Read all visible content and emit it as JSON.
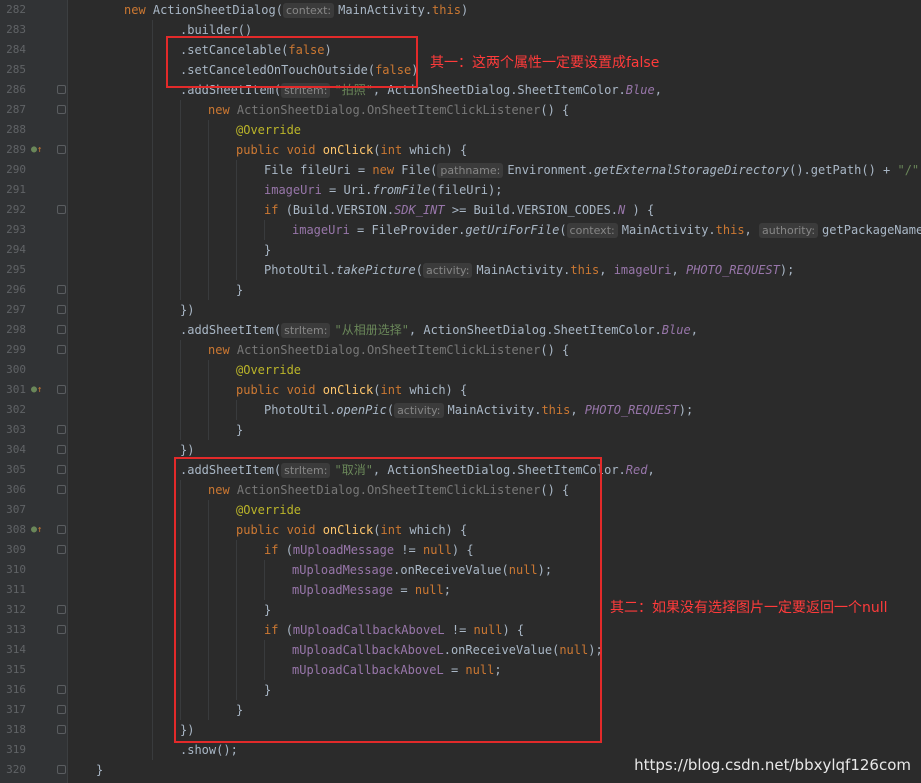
{
  "editor": {
    "lines": [
      {
        "n": "282",
        "indent": 0,
        "fold": false,
        "marker": false,
        "t": [
          [
            "kw",
            "new "
          ],
          [
            "",
            "ActionSheetDialog("
          ],
          [
            "hint",
            "context:"
          ],
          [
            "",
            "MainActivity."
          ],
          [
            "kw",
            "this"
          ],
          [
            "",
            ")"
          ]
        ]
      },
      {
        "n": "283",
        "indent": 1,
        "fold": false,
        "marker": false,
        "t": [
          [
            "",
            ".builder()"
          ]
        ]
      },
      {
        "n": "284",
        "indent": 1,
        "fold": false,
        "marker": false,
        "t": [
          [
            "",
            ".setCancelable("
          ],
          [
            "kw",
            "false"
          ],
          [
            "",
            ")"
          ]
        ]
      },
      {
        "n": "285",
        "indent": 1,
        "fold": false,
        "marker": false,
        "t": [
          [
            "",
            ".setCanceledOnTouchOutside("
          ],
          [
            "kw",
            "false"
          ],
          [
            "",
            ")"
          ]
        ]
      },
      {
        "n": "286",
        "indent": 1,
        "fold": true,
        "marker": false,
        "t": [
          [
            "",
            ".addSheetItem("
          ],
          [
            "hint",
            "strItem:"
          ],
          [
            "str",
            "\"拍照\""
          ],
          [
            "",
            ", ActionSheetDialog.SheetItemColor."
          ],
          [
            "fldi",
            "Blue"
          ],
          [
            "",
            ","
          ]
        ]
      },
      {
        "n": "287",
        "indent": 2,
        "fold": true,
        "marker": false,
        "t": [
          [
            "kw",
            "new "
          ],
          [
            "dim",
            "ActionSheetDialog.OnSheetItemClickListener"
          ],
          [
            "",
            "() {"
          ]
        ]
      },
      {
        "n": "288",
        "indent": 3,
        "fold": false,
        "marker": false,
        "t": [
          [
            "ann",
            "@Override"
          ]
        ]
      },
      {
        "n": "289",
        "indent": 3,
        "fold": true,
        "marker": true,
        "t": [
          [
            "kw",
            "public void "
          ],
          [
            "fn",
            "onClick"
          ],
          [
            "",
            "("
          ],
          [
            "kw",
            "int "
          ],
          [
            "",
            "which) {"
          ]
        ]
      },
      {
        "n": "290",
        "indent": 4,
        "fold": false,
        "marker": false,
        "t": [
          [
            "",
            "File fileUri = "
          ],
          [
            "kw",
            "new "
          ],
          [
            "",
            "File("
          ],
          [
            "hint",
            "pathname:"
          ],
          [
            "",
            "Environment."
          ],
          [
            "st",
            "getExternalStorageDirectory"
          ],
          [
            "",
            "().getPath() + "
          ],
          [
            "str",
            "\"/\""
          ],
          [
            "",
            " +"
          ]
        ]
      },
      {
        "n": "291",
        "indent": 4,
        "fold": false,
        "marker": false,
        "t": [
          [
            "fld",
            "imageUri"
          ],
          [
            "",
            " = Uri."
          ],
          [
            "st",
            "fromFile"
          ],
          [
            "",
            "(fileUri);"
          ]
        ]
      },
      {
        "n": "292",
        "indent": 4,
        "fold": true,
        "marker": false,
        "t": [
          [
            "kw",
            "if "
          ],
          [
            "",
            "(Build.VERSION."
          ],
          [
            "fldi",
            "SDK_INT"
          ],
          [
            "",
            " >= Build.VERSION_CODES."
          ],
          [
            "fldi",
            "N"
          ],
          [
            "",
            " ) {"
          ]
        ]
      },
      {
        "n": "293",
        "indent": 5,
        "fold": false,
        "marker": false,
        "t": [
          [
            "fld",
            "imageUri"
          ],
          [
            "",
            " = FileProvider."
          ],
          [
            "st",
            "getUriForFile"
          ],
          [
            "",
            "("
          ],
          [
            "hint",
            "context:"
          ],
          [
            "",
            "MainActivity."
          ],
          [
            "kw",
            "this"
          ],
          [
            "",
            ", "
          ],
          [
            "hint",
            "authority:"
          ],
          [
            "",
            "getPackageName("
          ]
        ]
      },
      {
        "n": "294",
        "indent": 4,
        "fold": false,
        "marker": false,
        "t": [
          [
            "",
            "}"
          ]
        ]
      },
      {
        "n": "295",
        "indent": 4,
        "fold": false,
        "marker": false,
        "t": [
          [
            "",
            "PhotoUtil."
          ],
          [
            "st",
            "takePicture"
          ],
          [
            "",
            "("
          ],
          [
            "hint",
            "activity:"
          ],
          [
            "",
            "MainActivity."
          ],
          [
            "kw",
            "this"
          ],
          [
            "",
            ", "
          ],
          [
            "fld",
            "imageUri"
          ],
          [
            "",
            ", "
          ],
          [
            "fldi",
            "PHOTO_REQUEST"
          ],
          [
            "",
            ");"
          ]
        ]
      },
      {
        "n": "296",
        "indent": 3,
        "fold": true,
        "marker": false,
        "t": [
          [
            "",
            "}"
          ]
        ]
      },
      {
        "n": "297",
        "indent": 1,
        "fold": true,
        "marker": false,
        "t": [
          [
            "",
            "})"
          ]
        ]
      },
      {
        "n": "298",
        "indent": 1,
        "fold": true,
        "marker": false,
        "t": [
          [
            "",
            ".addSheetItem("
          ],
          [
            "hint",
            "strItem:"
          ],
          [
            "str",
            "\"从相册选择\""
          ],
          [
            "",
            ", ActionSheetDialog.SheetItemColor."
          ],
          [
            "fldi",
            "Blue"
          ],
          [
            "",
            ","
          ]
        ]
      },
      {
        "n": "299",
        "indent": 2,
        "fold": true,
        "marker": false,
        "t": [
          [
            "kw",
            "new "
          ],
          [
            "dim",
            "ActionSheetDialog.OnSheetItemClickListener"
          ],
          [
            "",
            "() {"
          ]
        ]
      },
      {
        "n": "300",
        "indent": 3,
        "fold": false,
        "marker": false,
        "t": [
          [
            "ann",
            "@Override"
          ]
        ]
      },
      {
        "n": "301",
        "indent": 3,
        "fold": true,
        "marker": true,
        "t": [
          [
            "kw",
            "public void "
          ],
          [
            "fn",
            "onClick"
          ],
          [
            "",
            "("
          ],
          [
            "kw",
            "int "
          ],
          [
            "",
            "which) {"
          ]
        ]
      },
      {
        "n": "302",
        "indent": 4,
        "fold": false,
        "marker": false,
        "t": [
          [
            "",
            "PhotoUtil."
          ],
          [
            "st",
            "openPic"
          ],
          [
            "",
            "("
          ],
          [
            "hint",
            "activity:"
          ],
          [
            "",
            "MainActivity."
          ],
          [
            "kw",
            "this"
          ],
          [
            "",
            ", "
          ],
          [
            "fldi",
            "PHOTO_REQUEST"
          ],
          [
            "",
            ");"
          ]
        ]
      },
      {
        "n": "303",
        "indent": 3,
        "fold": true,
        "marker": false,
        "t": [
          [
            "",
            "}"
          ]
        ]
      },
      {
        "n": "304",
        "indent": 1,
        "fold": true,
        "marker": false,
        "t": [
          [
            "",
            "})"
          ]
        ]
      },
      {
        "n": "305",
        "indent": 1,
        "fold": true,
        "marker": false,
        "t": [
          [
            "",
            ".addSheetItem("
          ],
          [
            "hint",
            "strItem:"
          ],
          [
            "str",
            "\"取消\""
          ],
          [
            "",
            ", ActionSheetDialog.SheetItemColor."
          ],
          [
            "fldi",
            "Red"
          ],
          [
            "",
            ","
          ]
        ]
      },
      {
        "n": "306",
        "indent": 2,
        "fold": true,
        "marker": false,
        "t": [
          [
            "kw",
            "new "
          ],
          [
            "dim",
            "ActionSheetDialog.OnSheetItemClickListener"
          ],
          [
            "",
            "() {"
          ]
        ]
      },
      {
        "n": "307",
        "indent": 3,
        "fold": false,
        "marker": false,
        "t": [
          [
            "ann",
            "@Override"
          ]
        ]
      },
      {
        "n": "308",
        "indent": 3,
        "fold": true,
        "marker": true,
        "t": [
          [
            "kw",
            "public void "
          ],
          [
            "fn",
            "onClick"
          ],
          [
            "",
            "("
          ],
          [
            "kw",
            "int "
          ],
          [
            "",
            "which) {"
          ]
        ]
      },
      {
        "n": "309",
        "indent": 4,
        "fold": true,
        "marker": false,
        "t": [
          [
            "kw",
            "if "
          ],
          [
            "",
            "("
          ],
          [
            "fld",
            "mUploadMessage"
          ],
          [
            "",
            " != "
          ],
          [
            "kw",
            "null"
          ],
          [
            "",
            ") {"
          ]
        ]
      },
      {
        "n": "310",
        "indent": 5,
        "fold": false,
        "marker": false,
        "t": [
          [
            "fld",
            "mUploadMessage"
          ],
          [
            "",
            ".onReceiveValue("
          ],
          [
            "kw",
            "null"
          ],
          [
            "",
            ");"
          ]
        ]
      },
      {
        "n": "311",
        "indent": 5,
        "fold": false,
        "marker": false,
        "t": [
          [
            "fld",
            "mUploadMessage"
          ],
          [
            "",
            " = "
          ],
          [
            "kw",
            "null"
          ],
          [
            "",
            ";"
          ]
        ]
      },
      {
        "n": "312",
        "indent": 4,
        "fold": true,
        "marker": false,
        "t": [
          [
            "",
            "}"
          ]
        ]
      },
      {
        "n": "313",
        "indent": 4,
        "fold": true,
        "marker": false,
        "t": [
          [
            "kw",
            "if "
          ],
          [
            "",
            "("
          ],
          [
            "fld",
            "mUploadCallbackAboveL"
          ],
          [
            "",
            " != "
          ],
          [
            "kw",
            "null"
          ],
          [
            "",
            ") {"
          ]
        ]
      },
      {
        "n": "314",
        "indent": 5,
        "fold": false,
        "marker": false,
        "t": [
          [
            "fld",
            "mUploadCallbackAboveL"
          ],
          [
            "",
            ".onReceiveValue("
          ],
          [
            "kw",
            "null"
          ],
          [
            "",
            ");"
          ]
        ]
      },
      {
        "n": "315",
        "indent": 5,
        "fold": false,
        "marker": false,
        "t": [
          [
            "fld",
            "mUploadCallbackAboveL"
          ],
          [
            "",
            " = "
          ],
          [
            "kw",
            "null"
          ],
          [
            "",
            ";"
          ]
        ]
      },
      {
        "n": "316",
        "indent": 4,
        "fold": true,
        "marker": false,
        "t": [
          [
            "",
            "}"
          ]
        ]
      },
      {
        "n": "317",
        "indent": 3,
        "fold": true,
        "marker": false,
        "t": [
          [
            "",
            "}"
          ]
        ]
      },
      {
        "n": "318",
        "indent": 1,
        "fold": true,
        "marker": false,
        "t": [
          [
            "",
            "})"
          ]
        ]
      },
      {
        "n": "319",
        "indent": 1,
        "fold": false,
        "marker": false,
        "t": [
          [
            "",
            ".show();"
          ]
        ]
      },
      {
        "n": "320",
        "indent": -1,
        "fold": true,
        "marker": false,
        "t": [
          [
            "",
            "}"
          ]
        ]
      }
    ]
  },
  "annotations": {
    "note1": "其一：这两个属性一定要设置成false",
    "note2": "其二：如果没有选择图片一定要返回一个null"
  },
  "watermark": "https://blog.csdn.net/bbxylqf126com",
  "colors": {
    "highlight_box": "#e32a2a",
    "note_text": "#ff3b3b",
    "keyword": "#cc7832",
    "string": "#6a8759",
    "field": "#9876aa",
    "method": "#ffc66d",
    "annotation": "#bbb529"
  }
}
